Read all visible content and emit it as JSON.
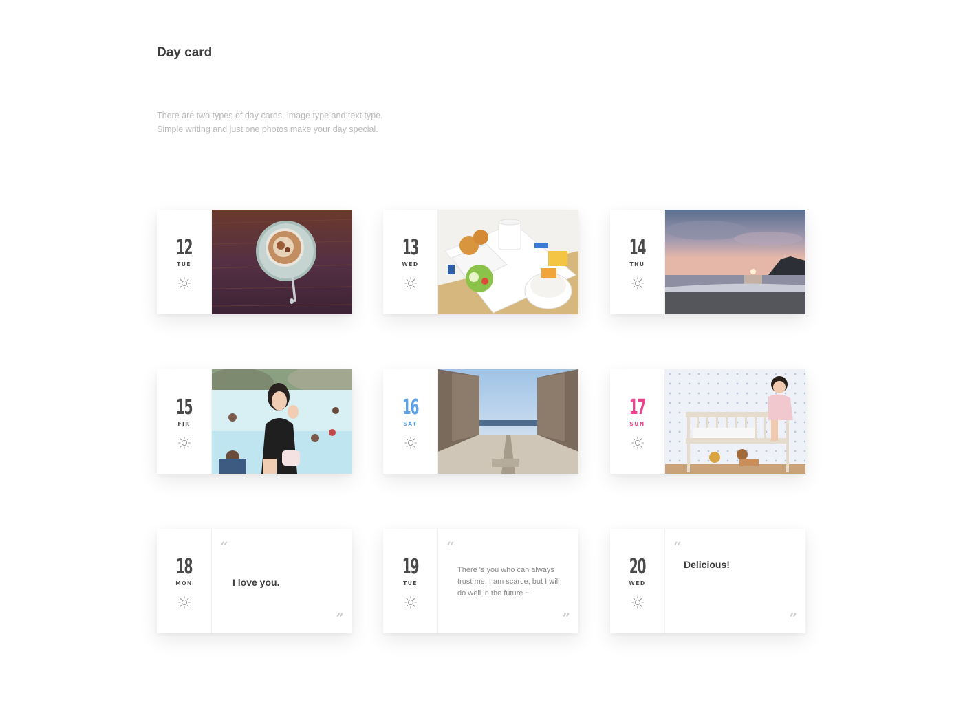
{
  "page": {
    "title": "Day card",
    "description_line1": "There are two types of day cards, image type and text type.",
    "description_line2": "Simple writing and just one photos make your day special."
  },
  "colors": {
    "saturday": "#5aa3ec",
    "sunday": "#e9448d",
    "text": "#4a4a4a"
  },
  "cards": [
    {
      "day": "12",
      "weekday": "TUE",
      "weather_icon": "sun-icon",
      "type": "image",
      "image": "coffee cup on wooden table"
    },
    {
      "day": "13",
      "weekday": "WED",
      "weather_icon": "sun-icon",
      "type": "image",
      "image": "breakfast tray"
    },
    {
      "day": "14",
      "weekday": "THU",
      "weather_icon": "sun-icon",
      "type": "image",
      "image": "sunset over beach"
    },
    {
      "day": "15",
      "weekday": "FIR",
      "weather_icon": "sun-icon",
      "type": "image",
      "image": "woman at swimming pool"
    },
    {
      "day": "16",
      "weekday": "SAT",
      "weather_icon": "sun-icon",
      "type": "image",
      "image": "concrete plaza facing ocean"
    },
    {
      "day": "17",
      "weekday": "SUN",
      "weather_icon": "sun-icon",
      "type": "image",
      "image": "child near crib"
    },
    {
      "day": "18",
      "weekday": "MON",
      "weather_icon": "sun-icon",
      "type": "text",
      "text": "I love you."
    },
    {
      "day": "19",
      "weekday": "TUE",
      "weather_icon": "sun-icon",
      "type": "text",
      "text": "There 's you who can always trust me. I am scarce, but I will do well in the future ~"
    },
    {
      "day": "20",
      "weekday": "WED",
      "weather_icon": "sun-icon",
      "type": "text",
      "text": "Delicious!"
    }
  ]
}
